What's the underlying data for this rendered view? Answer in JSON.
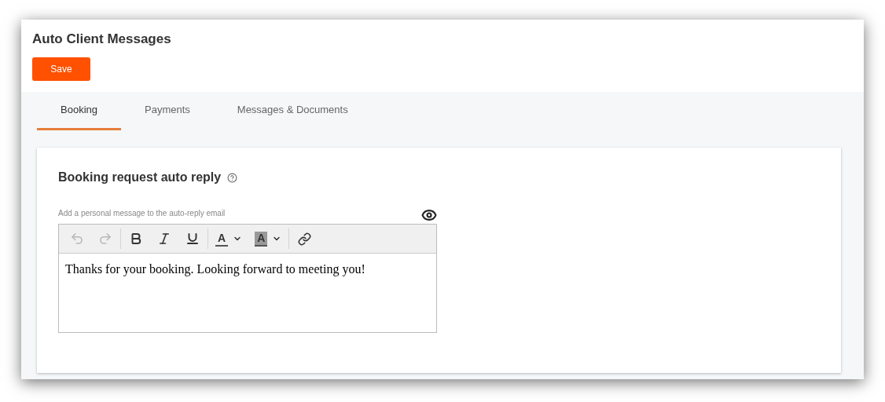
{
  "title": "Auto Client Messages",
  "save_button": "Save",
  "tabs": [
    {
      "label": "Booking",
      "selected": true
    },
    {
      "label": "Payments",
      "selected": false
    },
    {
      "label": "Messages & Documents",
      "selected": false
    }
  ],
  "section": {
    "title": "Booking request auto reply",
    "hint": "Add a personal message to the auto-reply email",
    "editor": {
      "toolbar": [
        [
          {
            "kind": "undo",
            "disabled": true
          },
          {
            "kind": "redo",
            "disabled": true
          }
        ],
        [
          {
            "kind": "bold",
            "disabled": false
          },
          {
            "kind": "italic",
            "disabled": false
          },
          {
            "kind": "underline",
            "disabled": false
          }
        ],
        [
          {
            "kind": "text-color",
            "label": "A",
            "disabled": false
          },
          {
            "kind": "highlight",
            "label": "A",
            "disabled": false
          }
        ],
        [
          {
            "kind": "link",
            "disabled": false
          }
        ]
      ],
      "value": "Thanks for your booking. Looking forward to meeting you!"
    }
  }
}
